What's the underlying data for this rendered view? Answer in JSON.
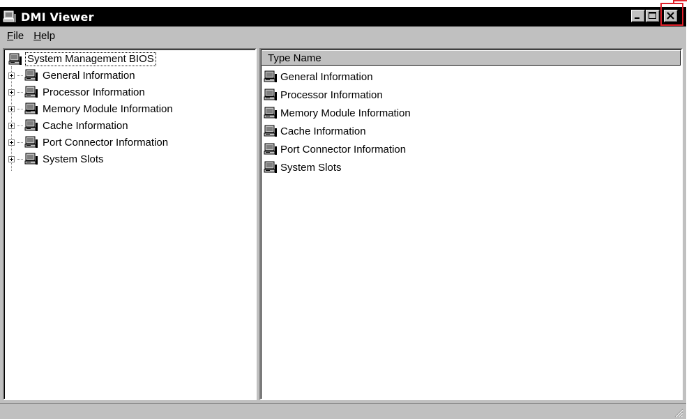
{
  "window": {
    "title": "DMI Viewer",
    "controls": [
      "minimize",
      "maximize",
      "close"
    ]
  },
  "menu": {
    "items": [
      {
        "label": "File",
        "accel": "F",
        "rest": "ile"
      },
      {
        "label": "Help",
        "accel": "H",
        "rest": "elp"
      }
    ]
  },
  "tree": {
    "root": "System Management BIOS",
    "items": [
      {
        "label": "General Information"
      },
      {
        "label": "Processor Information"
      },
      {
        "label": "Memory Module Information"
      },
      {
        "label": "Cache Information"
      },
      {
        "label": "Port Connector Information"
      },
      {
        "label": "System Slots"
      }
    ]
  },
  "list": {
    "column_header": "Type Name",
    "rows": [
      {
        "label": "General Information"
      },
      {
        "label": "Processor Information"
      },
      {
        "label": "Memory Module Information"
      },
      {
        "label": "Cache Information"
      },
      {
        "label": "Port Connector Information"
      },
      {
        "label": "System Slots"
      }
    ]
  },
  "icons": {
    "app": "computer-icon",
    "node": "computer-icon"
  },
  "colors": {
    "titlebar": "#000000",
    "face": "#c0c0c0",
    "highlight": "#e0202a"
  }
}
